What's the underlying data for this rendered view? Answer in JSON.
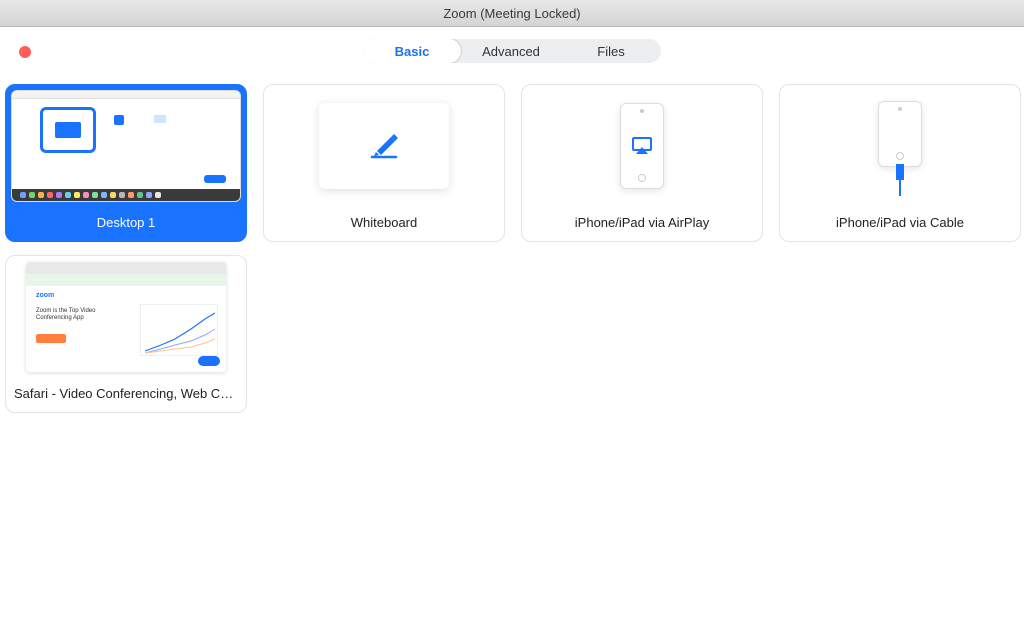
{
  "window": {
    "title": "Zoom (Meeting Locked)"
  },
  "tabs": {
    "basic": "Basic",
    "advanced": "Advanced",
    "files": "Files",
    "active": "basic"
  },
  "tiles": {
    "desktop": {
      "label": "Desktop 1",
      "selected": true
    },
    "whiteboard": {
      "label": "Whiteboard"
    },
    "airplay": {
      "label": "iPhone/iPad via AirPlay"
    },
    "cable": {
      "label": "iPhone/iPad via Cable"
    },
    "safari": {
      "label": "Safari - Video Conferencing, Web Conferencing, Webinars"
    }
  },
  "safari_preview": {
    "logo": "zoom",
    "headline": "Zoom is the Top Video Conferencing App"
  },
  "colors": {
    "accent": "#1a73ff",
    "orange": "#ff7f3f"
  }
}
